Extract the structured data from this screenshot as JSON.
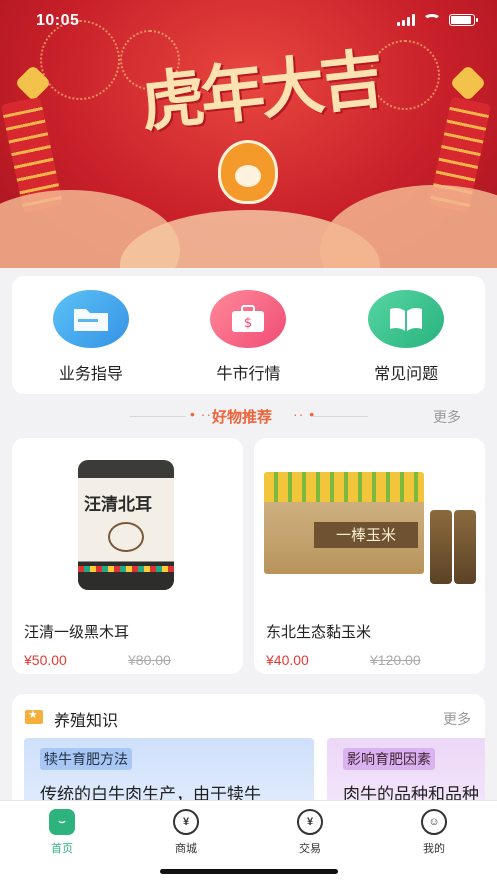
{
  "status_bar": {
    "time": "10:05",
    "battery_level": 0.9
  },
  "hero": {
    "slogan": "虎年大吉"
  },
  "quick_entries": [
    {
      "label": "业务指导",
      "icon": "folder-icon",
      "color": "#3592e6"
    },
    {
      "label": "牛市行情",
      "icon": "briefcase-icon",
      "color": "#f04b75"
    },
    {
      "label": "常见问题",
      "icon": "book-icon",
      "color": "#28b27f"
    }
  ],
  "recommend": {
    "title": "好物推荐",
    "dots_left": "• ··",
    "dots_right": "·· •",
    "more": "更多"
  },
  "products": [
    {
      "name": "汪清一级黑木耳",
      "price": "¥50.00",
      "original_price": "¥80.00",
      "image_text": "汪清北耳"
    },
    {
      "name": "东北生态黏玉米",
      "price": "¥40.00",
      "original_price": "¥120.00",
      "image_text": "一棒玉米"
    }
  ],
  "knowledge": {
    "title": "养殖知识",
    "more": "更多",
    "cards": [
      {
        "tag": "犊牛育肥方法",
        "text": "传统的白牛肉生产，由于犊牛"
      },
      {
        "tag": "影响育肥因素",
        "text": "肉牛的品种和品种"
      }
    ]
  },
  "tabs": [
    {
      "label": "首页",
      "glyph": "⌣",
      "active": true
    },
    {
      "label": "商城",
      "glyph": "¥",
      "active": false
    },
    {
      "label": "交易",
      "glyph": "¥",
      "active": false
    },
    {
      "label": "我的",
      "glyph": "☺",
      "active": false
    }
  ],
  "colors": {
    "accent": "#2fb37e",
    "price": "#e53935",
    "section_title": "#f0633a"
  }
}
